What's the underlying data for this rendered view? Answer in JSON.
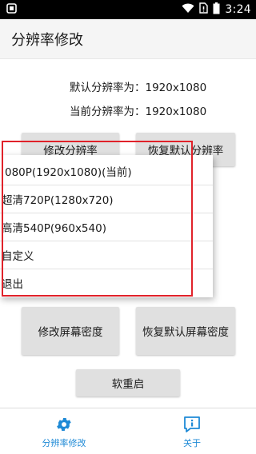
{
  "status_bar": {
    "time": "3:24",
    "icons": [
      "notification-icon",
      "wifi-icon",
      "no-sim-icon",
      "battery-icon"
    ]
  },
  "app_bar": {
    "title": "分辨率修改"
  },
  "info": {
    "default_resolution": "默认分辨率为：1920x1080",
    "current_resolution": "当前分辨率为：1920x1080"
  },
  "buttons": {
    "modify_resolution": "修改分辨率",
    "restore_default_resolution": "恢复默认分辨率",
    "modify_density": "修改屏幕密度",
    "restore_default_density": "恢复默认屏幕密度",
    "reboot": "软重启"
  },
  "popup_menu": {
    "items": [
      "080P(1920x1080)(当前)",
      "超清720P(1280x720)",
      "高清540P(960x540)",
      "自定义",
      "退出"
    ]
  },
  "bottom_nav": {
    "items": [
      {
        "label": "分辨率修改",
        "icon": "gear-icon",
        "active": true
      },
      {
        "label": "关于",
        "icon": "info-chat-icon",
        "active": true
      }
    ]
  },
  "colors": {
    "accent": "#1f8ad6",
    "highlight": "#e0222a",
    "status_bar": "#000000",
    "app_bar": "#f5f5f5",
    "button": "#e0e0e0"
  }
}
